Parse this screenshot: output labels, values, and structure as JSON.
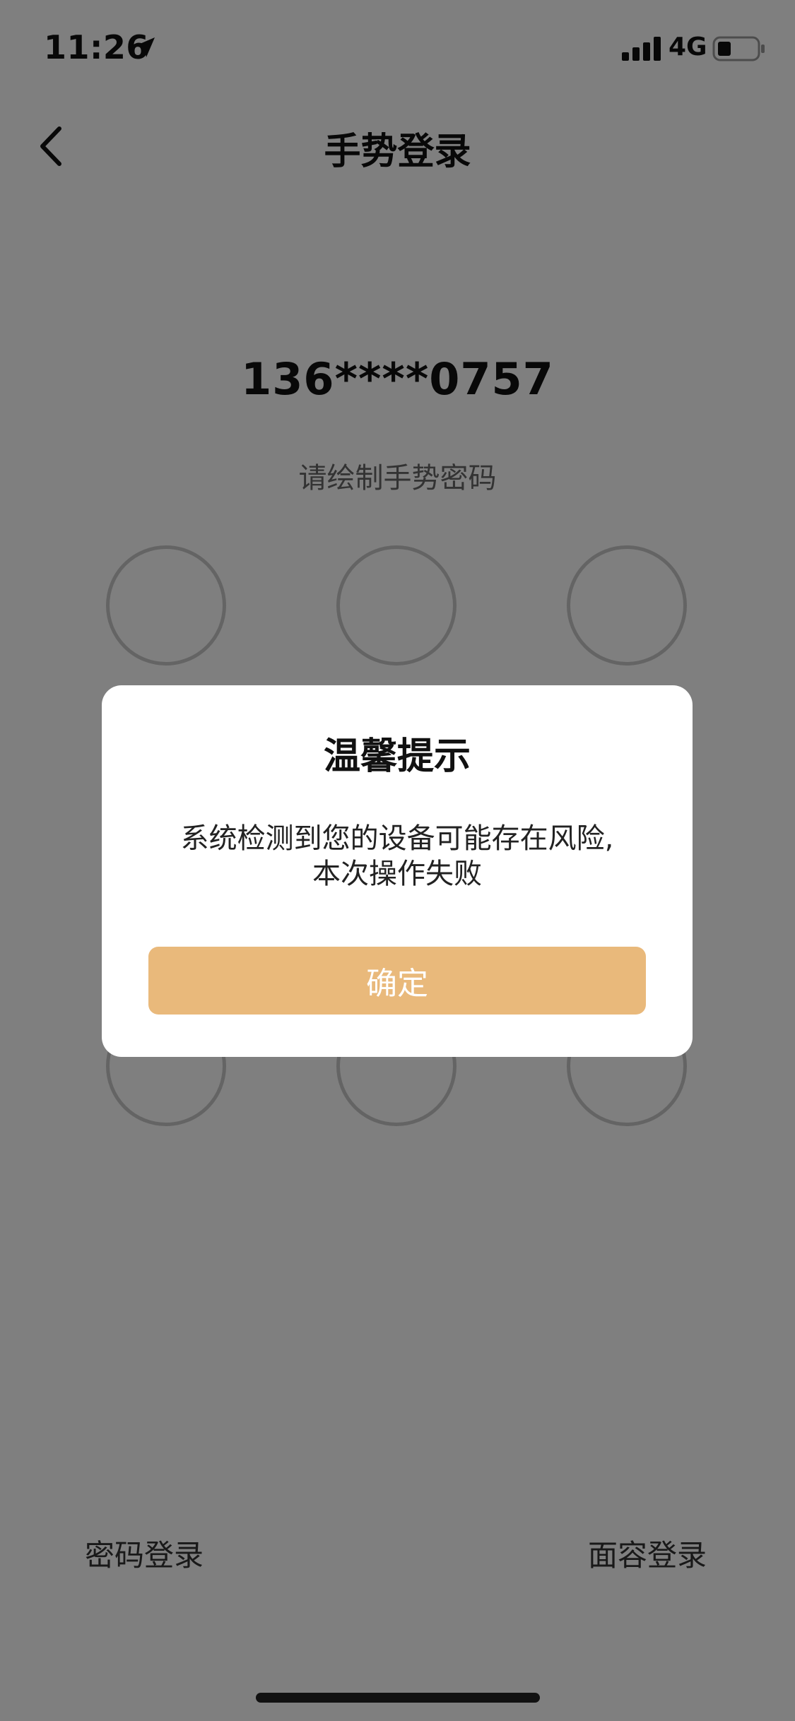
{
  "status_bar": {
    "time": "11:26",
    "network": "4G"
  },
  "nav": {
    "title": "手势登录"
  },
  "account": {
    "phone": "136****0757",
    "hint": "请绘制手势密码"
  },
  "links": {
    "password_login": "密码登录",
    "face_login": "面容登录"
  },
  "dialog": {
    "title": "温馨提示",
    "message_line1": "系统检测到您的设备可能存在风险,",
    "message_line2": "本次操作失败",
    "confirm_label": "确定"
  },
  "colors": {
    "accent": "#e9b97b",
    "overlay": "#7f7f7f"
  }
}
